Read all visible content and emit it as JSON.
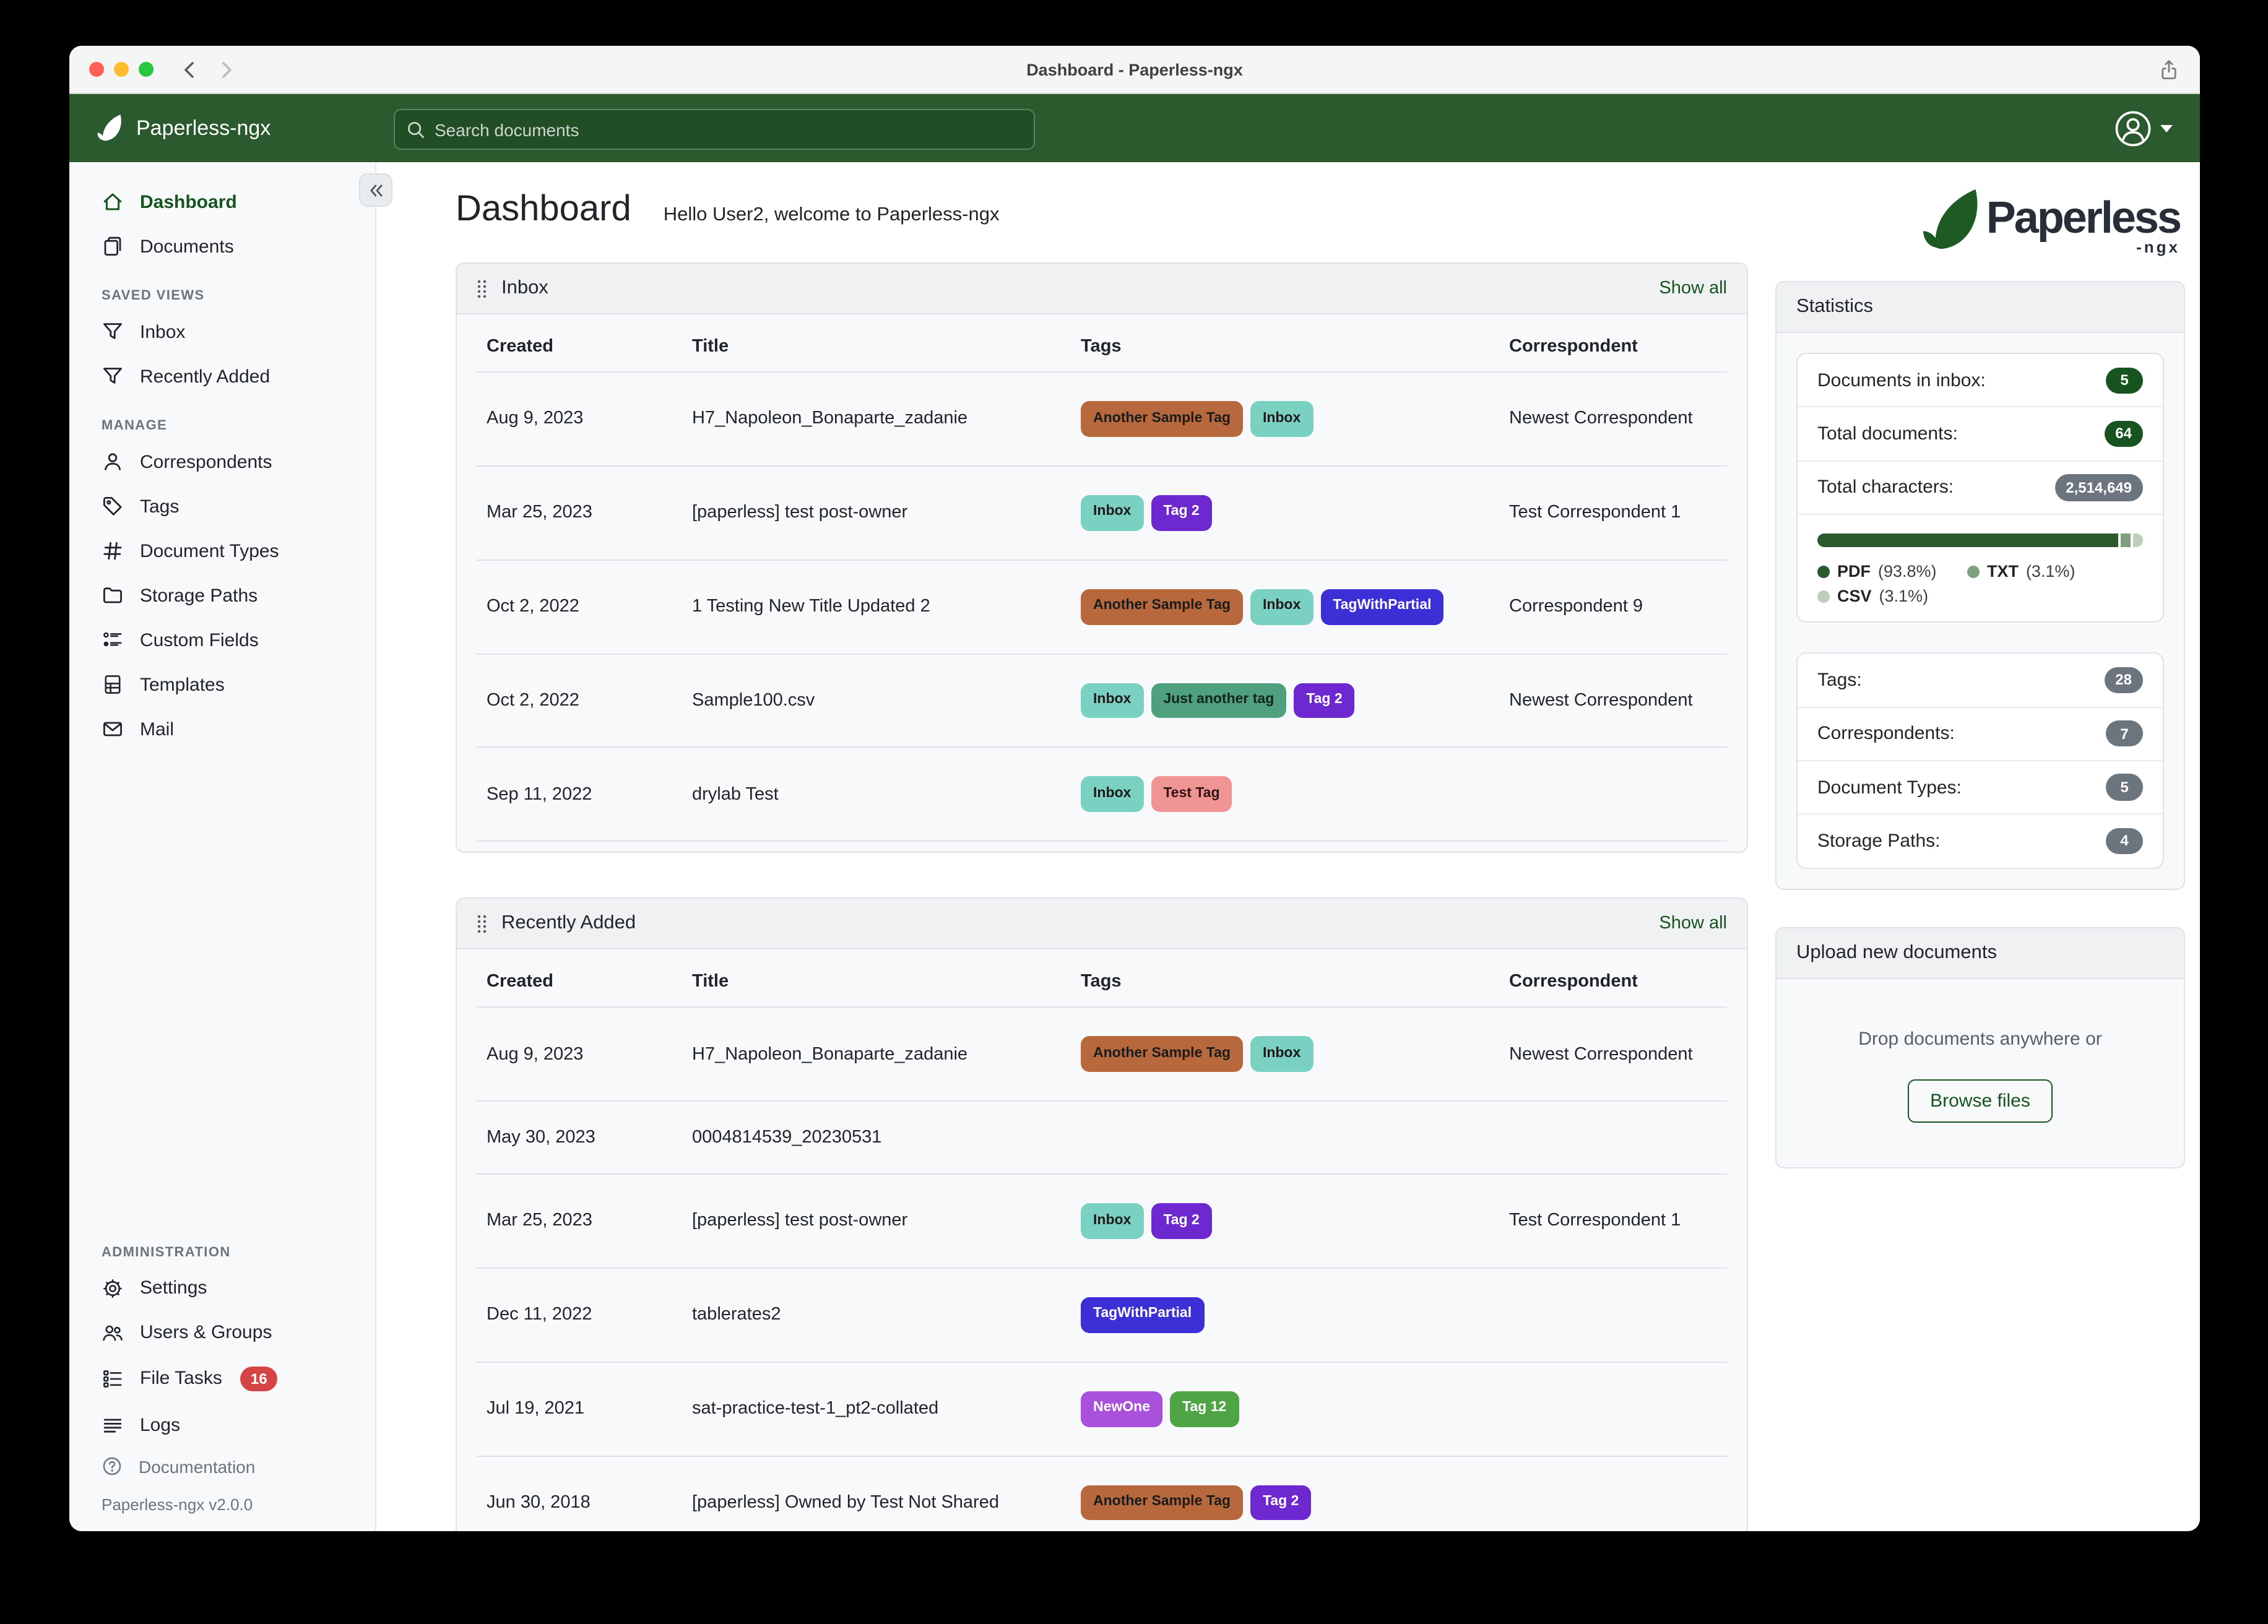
{
  "window": {
    "title": "Dashboard - Paperless-ngx"
  },
  "navbar": {
    "brand": "Paperless-ngx",
    "search_placeholder": "Search documents"
  },
  "sidebar": {
    "sections": {
      "saved_views": "SAVED VIEWS",
      "manage": "MANAGE",
      "administration": "ADMINISTRATION"
    },
    "items": {
      "dashboard": "Dashboard",
      "documents": "Documents",
      "inbox": "Inbox",
      "recently_added": "Recently Added",
      "correspondents": "Correspondents",
      "tags": "Tags",
      "document_types": "Document Types",
      "storage_paths": "Storage Paths",
      "custom_fields": "Custom Fields",
      "templates": "Templates",
      "mail": "Mail",
      "settings": "Settings",
      "users_groups": "Users & Groups",
      "file_tasks": "File Tasks",
      "logs": "Logs",
      "documentation": "Documentation"
    },
    "file_tasks_badge": "16",
    "version": "Paperless-ngx v2.0.0"
  },
  "page": {
    "title": "Dashboard",
    "greeting": "Hello User2, welcome to Paperless-ngx",
    "logo_text": "Paperless",
    "logo_suffix": "-ngx"
  },
  "tables": {
    "show_all": "Show all",
    "columns": {
      "created": "Created",
      "title": "Title",
      "tags": "Tags",
      "correspondent": "Correspondent"
    },
    "inbox": {
      "title": "Inbox",
      "rows": [
        {
          "created": "Aug 9, 2023",
          "title": "H7_Napoleon_Bonaparte_zadanie",
          "correspondent": "Newest Correspondent",
          "tags": [
            {
              "label": "Another Sample Tag",
              "bg": "#b7693d",
              "fg": "#1b1b1b"
            },
            {
              "label": "Inbox",
              "bg": "#7ad1c1",
              "fg": "#1b1b1b"
            }
          ]
        },
        {
          "created": "Mar 25, 2023",
          "title": "[paperless] test post-owner",
          "correspondent": "Test Correspondent 1",
          "tags": [
            {
              "label": "Inbox",
              "bg": "#7ad1c1",
              "fg": "#1b1b1b"
            },
            {
              "label": "Tag 2",
              "bg": "#6d28cf",
              "fg": "#ffffff"
            }
          ]
        },
        {
          "created": "Oct 2, 2022",
          "title": "1 Testing New Title Updated 2",
          "correspondent": "Correspondent 9",
          "tags": [
            {
              "label": "Another Sample Tag",
              "bg": "#b7693d",
              "fg": "#1b1b1b"
            },
            {
              "label": "Inbox",
              "bg": "#7ad1c1",
              "fg": "#1b1b1b"
            },
            {
              "label": "TagWithPartial",
              "bg": "#3c2fd6",
              "fg": "#ffffff"
            }
          ]
        },
        {
          "created": "Oct 2, 2022",
          "title": "Sample100.csv",
          "correspondent": "Newest Correspondent",
          "tags": [
            {
              "label": "Inbox",
              "bg": "#7ad1c1",
              "fg": "#1b1b1b"
            },
            {
              "label": "Just another tag",
              "bg": "#4fa07f",
              "fg": "#14241c"
            },
            {
              "label": "Tag 2",
              "bg": "#6d28cf",
              "fg": "#ffffff"
            }
          ]
        },
        {
          "created": "Sep 11, 2022",
          "title": "drylab Test",
          "correspondent": "",
          "tags": [
            {
              "label": "Inbox",
              "bg": "#7ad1c1",
              "fg": "#1b1b1b"
            },
            {
              "label": "Test Tag",
              "bg": "#f09494",
              "fg": "#301414"
            }
          ]
        }
      ]
    },
    "recently_added": {
      "title": "Recently Added",
      "rows": [
        {
          "created": "Aug 9, 2023",
          "title": "H7_Napoleon_Bonaparte_zadanie",
          "correspondent": "Newest Correspondent",
          "tags": [
            {
              "label": "Another Sample Tag",
              "bg": "#b7693d",
              "fg": "#1b1b1b"
            },
            {
              "label": "Inbox",
              "bg": "#7ad1c1",
              "fg": "#1b1b1b"
            }
          ]
        },
        {
          "created": "May 30, 2023",
          "title": "0004814539_20230531",
          "correspondent": "",
          "tags": []
        },
        {
          "created": "Mar 25, 2023",
          "title": "[paperless] test post-owner",
          "correspondent": "Test Correspondent 1",
          "tags": [
            {
              "label": "Inbox",
              "bg": "#7ad1c1",
              "fg": "#1b1b1b"
            },
            {
              "label": "Tag 2",
              "bg": "#6d28cf",
              "fg": "#ffffff"
            }
          ]
        },
        {
          "created": "Dec 11, 2022",
          "title": "tablerates2",
          "correspondent": "",
          "tags": [
            {
              "label": "TagWithPartial",
              "bg": "#3c2fd6",
              "fg": "#ffffff"
            }
          ]
        },
        {
          "created": "Jul 19, 2021",
          "title": "sat-practice-test-1_pt2-collated",
          "correspondent": "",
          "tags": [
            {
              "label": "NewOne",
              "bg": "#a950dd",
              "fg": "#ffffff"
            },
            {
              "label": "Tag 12",
              "bg": "#4fa446",
              "fg": "#ffffff"
            }
          ]
        },
        {
          "created": "Jun 30, 2018",
          "title": "[paperless] Owned by Test Not Shared",
          "correspondent": "",
          "tags": [
            {
              "label": "Another Sample Tag",
              "bg": "#b7693d",
              "fg": "#1b1b1b"
            },
            {
              "label": "Tag 2",
              "bg": "#6d28cf",
              "fg": "#ffffff"
            }
          ]
        }
      ]
    }
  },
  "statistics": {
    "title": "Statistics",
    "rows": [
      {
        "label": "Documents in inbox:",
        "value": "5",
        "color": "#17541f"
      },
      {
        "label": "Total documents:",
        "value": "64",
        "color": "#17541f"
      },
      {
        "label": "Total characters:",
        "value": "2,514,649",
        "color": "#6c757d"
      }
    ],
    "chart": {
      "segments": [
        {
          "name": "PDF",
          "pct_label": "(93.8%)",
          "width": "93.8%",
          "color": "#2c592c"
        },
        {
          "name": "TXT",
          "pct_label": "(3.1%)",
          "width": "3.1%",
          "color": "#7f9f7d"
        },
        {
          "name": "CSV",
          "pct_label": "(3.1%)",
          "width": "3.1%",
          "color": "#c0cdbd"
        }
      ]
    },
    "counts": [
      {
        "label": "Tags:",
        "value": "28",
        "color": "#6c757d"
      },
      {
        "label": "Correspondents:",
        "value": "7",
        "color": "#6c757d"
      },
      {
        "label": "Document Types:",
        "value": "5",
        "color": "#6c757d"
      },
      {
        "label": "Storage Paths:",
        "value": "4",
        "color": "#6c757d"
      }
    ]
  },
  "upload": {
    "title": "Upload new documents",
    "drop_text": "Drop documents anywhere or",
    "browse_label": "Browse files"
  }
}
